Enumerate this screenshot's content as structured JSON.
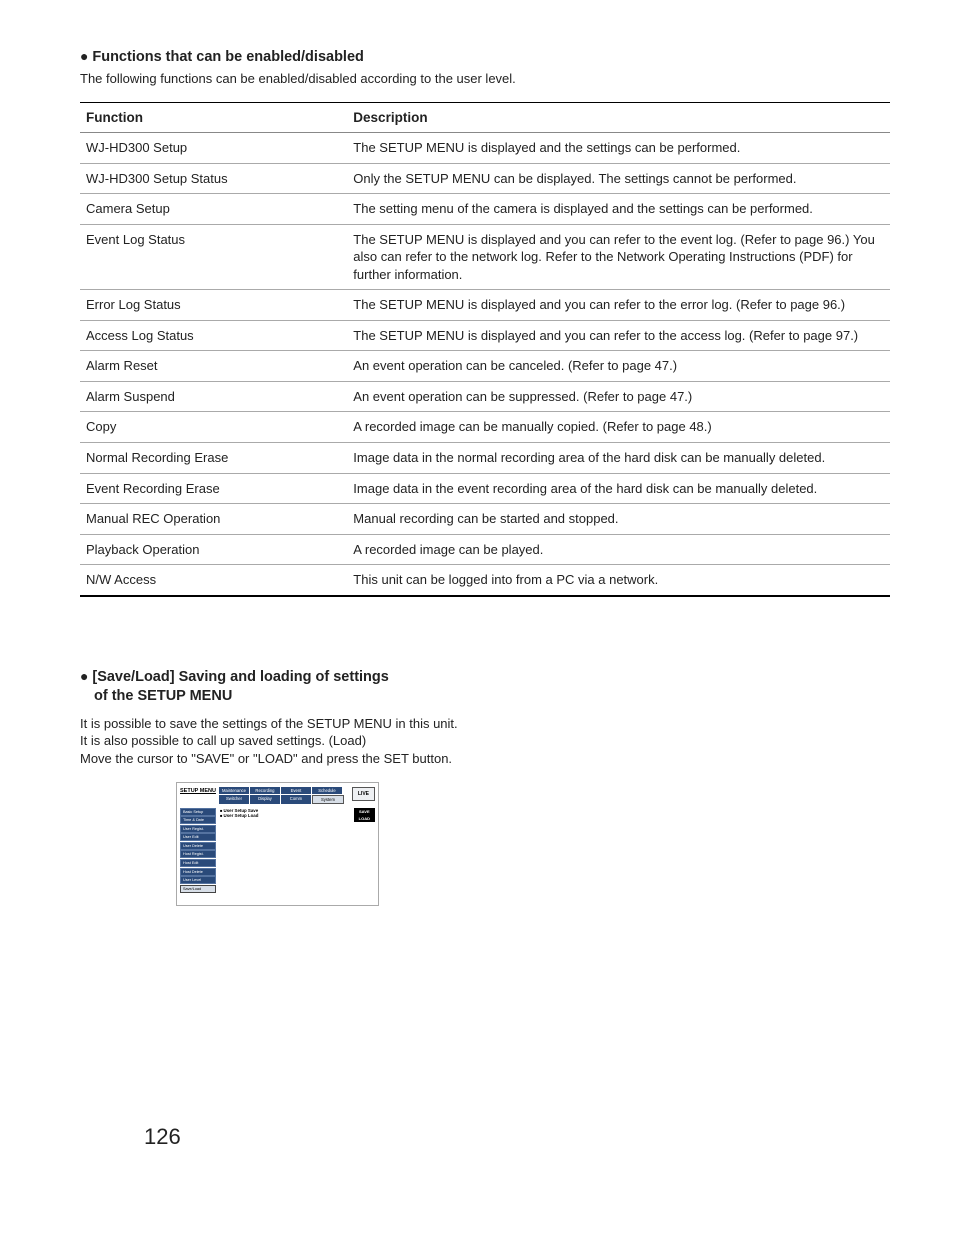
{
  "section1": {
    "heading": "Functions that can be enabled/disabled",
    "intro": "The following functions can be enabled/disabled according to the user level.",
    "headers": {
      "c0": "Function",
      "c1": "Description"
    },
    "rows": [
      {
        "f": "WJ-HD300 Setup",
        "d": "The SETUP MENU is displayed and the settings can be performed."
      },
      {
        "f": "WJ-HD300 Setup Status",
        "d": "Only the SETUP MENU can be displayed. The settings cannot be performed."
      },
      {
        "f": "Camera Setup",
        "d": "The setting menu of the camera is displayed and the settings can be performed."
      },
      {
        "f": "Event Log Status",
        "d": "The SETUP MENU is displayed and you can refer to the event log. (Refer to page 96.) You also can refer to the network log. Refer to the Network Operating Instructions (PDF) for further information."
      },
      {
        "f": "Error Log Status",
        "d": "The SETUP MENU is displayed and you can refer to the error log. (Refer to page 96.)"
      },
      {
        "f": "Access Log Status",
        "d": "The SETUP MENU is displayed and you can refer to the access log. (Refer to page 97.)"
      },
      {
        "f": "Alarm Reset",
        "d": "An event operation can be canceled. (Refer to page 47.)"
      },
      {
        "f": "Alarm Suspend",
        "d": "An event operation can be suppressed. (Refer to page 47.)"
      },
      {
        "f": "Copy",
        "d": "A recorded image can be manually copied. (Refer to page 48.)"
      },
      {
        "f": "Normal Recording Erase",
        "d": "Image data in the normal recording area of the hard disk can be manually deleted."
      },
      {
        "f": "Event Recording Erase",
        "d": "Image data in the event recording area of the hard disk can be manually deleted."
      },
      {
        "f": "Manual REC Operation",
        "d": "Manual recording can be started and stopped."
      },
      {
        "f": "Playback Operation",
        "d": "A recorded image can be played."
      },
      {
        "f": "N/W Access",
        "d": "This unit can be logged into from a PC via a network."
      }
    ]
  },
  "section2": {
    "heading_l1": "[Save/Load] Saving and loading of settings",
    "heading_l2": "of the SETUP MENU",
    "p1": "It is possible to save the settings of the SETUP MENU in this unit.",
    "p2": "It is also possible to call up saved settings. (Load)",
    "p3": "Move the cursor to \"SAVE\" or \"LOAD\" and press the SET button."
  },
  "screenshot": {
    "title": "SETUP MENU",
    "tabs_row1": [
      "Maintenance",
      "Recording",
      "Event",
      "Schedule"
    ],
    "tabs_row2": [
      "Switcher",
      "Display",
      "Comm",
      "System"
    ],
    "live": "LIVE",
    "side": [
      "Basic Setup",
      "Time & Date",
      "User Regist.",
      "User Edit",
      "User Delete",
      "Host Regist.",
      "Host Edit",
      "Host Delete",
      "User Level",
      "Save/Load"
    ],
    "opts": [
      "User Setup Save",
      "User Setup Load"
    ],
    "actions": [
      "SAVE",
      "LOAD"
    ]
  },
  "page_number": "126"
}
